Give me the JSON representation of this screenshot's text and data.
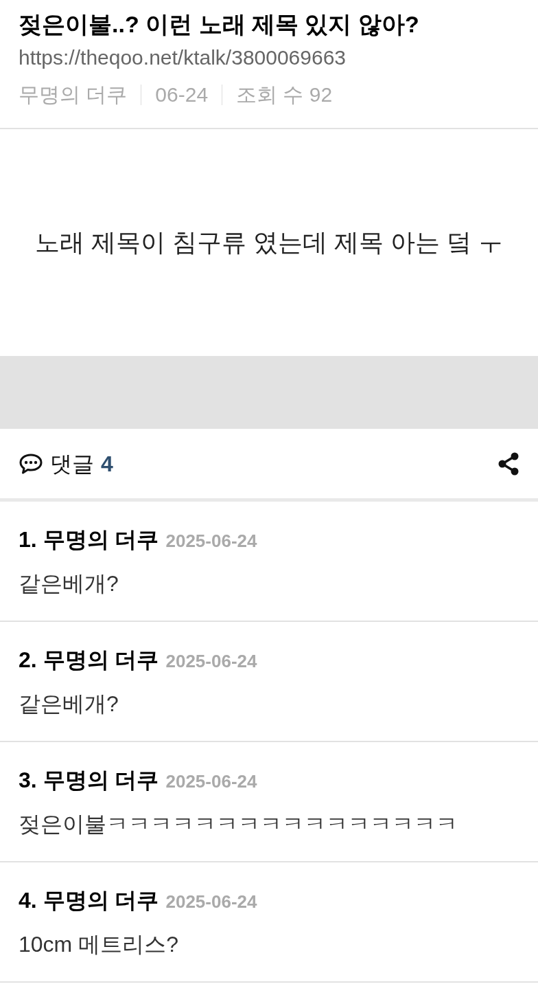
{
  "post": {
    "title": "젖은이불..? 이런 노래 제목 있지 않아?",
    "url": "https://theqoo.net/ktalk/3800069663",
    "author": "무명의 더쿠",
    "date": "06-24",
    "views": "조회 수 92",
    "body": "노래 제목이 침구류 였는데 제목 아는 덬 ㅜ"
  },
  "comments_header": {
    "label": "댓글",
    "count": "4"
  },
  "comments": [
    {
      "number": "1.",
      "author": "무명의 더쿠",
      "date": "2025-06-24",
      "text": "같은베개?"
    },
    {
      "number": "2.",
      "author": "무명의 더쿠",
      "date": "2025-06-24",
      "text": "같은베개?"
    },
    {
      "number": "3.",
      "author": "무명의 더쿠",
      "date": "2025-06-24",
      "text": "젖은이불ㅋㅋㅋㅋㅋㅋㅋㅋㅋㅋㅋㅋㅋㅋㅋㅋ"
    },
    {
      "number": "4.",
      "author": "무명의 더쿠",
      "date": "2025-06-24",
      "text": "10cm 메트리스?"
    }
  ]
}
